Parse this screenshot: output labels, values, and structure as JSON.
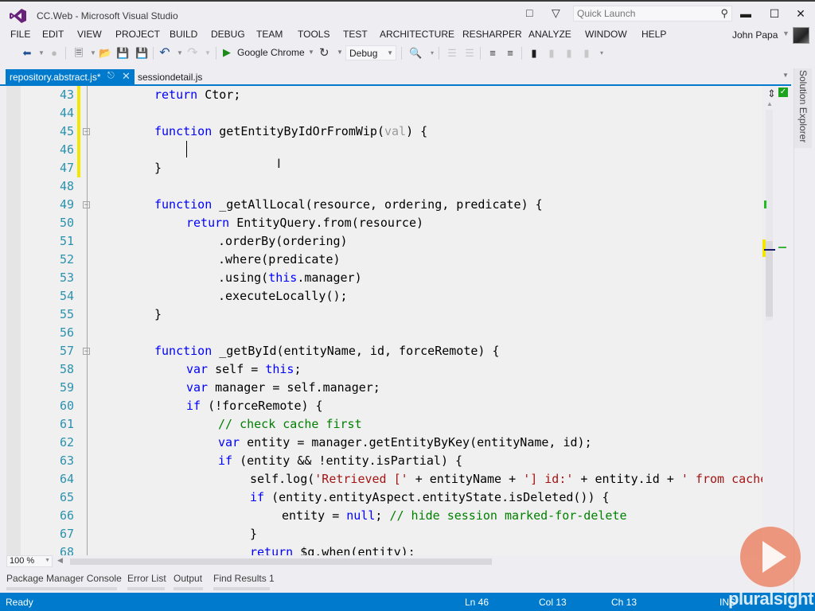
{
  "window": {
    "title": "CC.Web - Microsoft Visual Studio",
    "quick_launch_placeholder": "Quick Launch",
    "minimize_glyph": "▬",
    "maximize_glyph": "☐",
    "close_glyph": "✕"
  },
  "menu": {
    "items": [
      "FILE",
      "EDIT",
      "VIEW",
      "PROJECT",
      "BUILD",
      "DEBUG",
      "TEAM",
      "TOOLS",
      "TEST",
      "ARCHITECTURE",
      "RESHARPER",
      "ANALYZE",
      "WINDOW",
      "HELP"
    ],
    "user_name": "John Papa"
  },
  "toolbar": {
    "run_target": "Google Chrome",
    "configuration": "Debug",
    "icons": [
      "back-icon",
      "forward-icon",
      "new-project-icon",
      "open-file-icon",
      "save-icon",
      "save-all-icon",
      "undo-icon",
      "redo-icon",
      "start-debugging-icon",
      "refresh-icon",
      "find-in-files-icon",
      "comment-icon",
      "uncomment-icon",
      "decrease-indent-icon",
      "increase-indent-icon",
      "bookmark-icon",
      "prev-bookmark-icon",
      "next-bookmark-icon",
      "clear-bookmarks-icon"
    ]
  },
  "tabs": [
    {
      "label": "repository.abstract.js*",
      "active": true
    },
    {
      "label": "sessiondetail.js",
      "active": false
    }
  ],
  "side_panel": {
    "solution_explorer": "Solution Explorer"
  },
  "editor": {
    "accent_change_color": "#f1e700",
    "lines": [
      {
        "n": "43",
        "indent": 2,
        "tokens": [
          {
            "t": "return",
            "c": "kw"
          },
          {
            "t": " Ctor;"
          }
        ],
        "changed": true
      },
      {
        "n": "44",
        "indent": 0,
        "tokens": [],
        "changed": true
      },
      {
        "n": "45",
        "indent": 2,
        "tokens": [
          {
            "t": "function",
            "c": "kw"
          },
          {
            "t": " getEntityByIdOrFromWip("
          },
          {
            "t": "val",
            "c": "unused"
          },
          {
            "t": ") {"
          }
        ],
        "changed": true,
        "fold": true
      },
      {
        "n": "46",
        "indent": 0,
        "tokens": [],
        "changed": true
      },
      {
        "n": "47",
        "indent": 2,
        "tokens": [
          {
            "t": "}"
          }
        ],
        "changed": true
      },
      {
        "n": "48",
        "indent": 0,
        "tokens": []
      },
      {
        "n": "49",
        "indent": 2,
        "tokens": [
          {
            "t": "function",
            "c": "kw"
          },
          {
            "t": " _getAllLocal(resource, ordering, predicate) {"
          }
        ],
        "fold": true
      },
      {
        "n": "50",
        "indent": 3,
        "tokens": [
          {
            "t": "return",
            "c": "kw"
          },
          {
            "t": " EntityQuery.from(resource)"
          }
        ]
      },
      {
        "n": "51",
        "indent": 4,
        "tokens": [
          {
            "t": ".orderBy(ordering)"
          }
        ]
      },
      {
        "n": "52",
        "indent": 4,
        "tokens": [
          {
            "t": ".where(predicate)"
          }
        ]
      },
      {
        "n": "53",
        "indent": 4,
        "tokens": [
          {
            "t": ".using("
          },
          {
            "t": "this",
            "c": "kw"
          },
          {
            "t": ".manager)"
          }
        ]
      },
      {
        "n": "54",
        "indent": 4,
        "tokens": [
          {
            "t": ".executeLocally();"
          }
        ]
      },
      {
        "n": "55",
        "indent": 2,
        "tokens": [
          {
            "t": "}"
          }
        ]
      },
      {
        "n": "56",
        "indent": 0,
        "tokens": []
      },
      {
        "n": "57",
        "indent": 2,
        "tokens": [
          {
            "t": "function",
            "c": "kw"
          },
          {
            "t": " _getById(entityName, id, forceRemote) {"
          }
        ],
        "fold": true
      },
      {
        "n": "58",
        "indent": 3,
        "tokens": [
          {
            "t": "var",
            "c": "kw"
          },
          {
            "t": " self = "
          },
          {
            "t": "this",
            "c": "kw"
          },
          {
            "t": ";"
          }
        ]
      },
      {
        "n": "59",
        "indent": 3,
        "tokens": [
          {
            "t": "var",
            "c": "kw"
          },
          {
            "t": " manager = self.manager;"
          }
        ]
      },
      {
        "n": "60",
        "indent": 3,
        "tokens": [
          {
            "t": "if",
            "c": "kw"
          },
          {
            "t": " (!forceRemote) {"
          }
        ]
      },
      {
        "n": "61",
        "indent": 4,
        "tokens": [
          {
            "t": "// check cache first",
            "c": "cm"
          }
        ]
      },
      {
        "n": "62",
        "indent": 4,
        "tokens": [
          {
            "t": "var",
            "c": "kw"
          },
          {
            "t": " entity = manager.getEntityByKey(entityName, id);"
          }
        ]
      },
      {
        "n": "63",
        "indent": 4,
        "tokens": [
          {
            "t": "if",
            "c": "kw"
          },
          {
            "t": " (entity && !entity.isPartial) {"
          }
        ]
      },
      {
        "n": "64",
        "indent": 5,
        "tokens": [
          {
            "t": "self.log("
          },
          {
            "t": "'Retrieved ['",
            "c": "str"
          },
          {
            "t": " + entityName + "
          },
          {
            "t": "'] id:'",
            "c": "str"
          },
          {
            "t": " + entity.id + "
          },
          {
            "t": "' from cache.'",
            "c": "str"
          }
        ]
      },
      {
        "n": "65",
        "indent": 5,
        "tokens": [
          {
            "t": "if",
            "c": "kw"
          },
          {
            "t": " (entity.entityAspect.entityState.isDeleted()) {"
          }
        ]
      },
      {
        "n": "66",
        "indent": 6,
        "tokens": [
          {
            "t": "entity = "
          },
          {
            "t": "null",
            "c": "kw"
          },
          {
            "t": "; "
          },
          {
            "t": "// hide session marked-for-delete",
            "c": "cm"
          }
        ]
      },
      {
        "n": "67",
        "indent": 5,
        "tokens": [
          {
            "t": "}"
          }
        ]
      },
      {
        "n": "68",
        "indent": 5,
        "tokens": [
          {
            "t": "return",
            "c": "kw"
          },
          {
            "t": " $q.when(entity);"
          }
        ]
      }
    ]
  },
  "editor_footer": {
    "zoom_level": "100 %"
  },
  "tool_tabs": [
    "Package Manager Console",
    "Error List",
    "Output",
    "Find Results 1"
  ],
  "status": {
    "state": "Ready",
    "line": "Ln 46",
    "column": "Col 13",
    "char": "Ch 13",
    "mode": "INS"
  },
  "watermark": {
    "brand": "pluralsight"
  }
}
